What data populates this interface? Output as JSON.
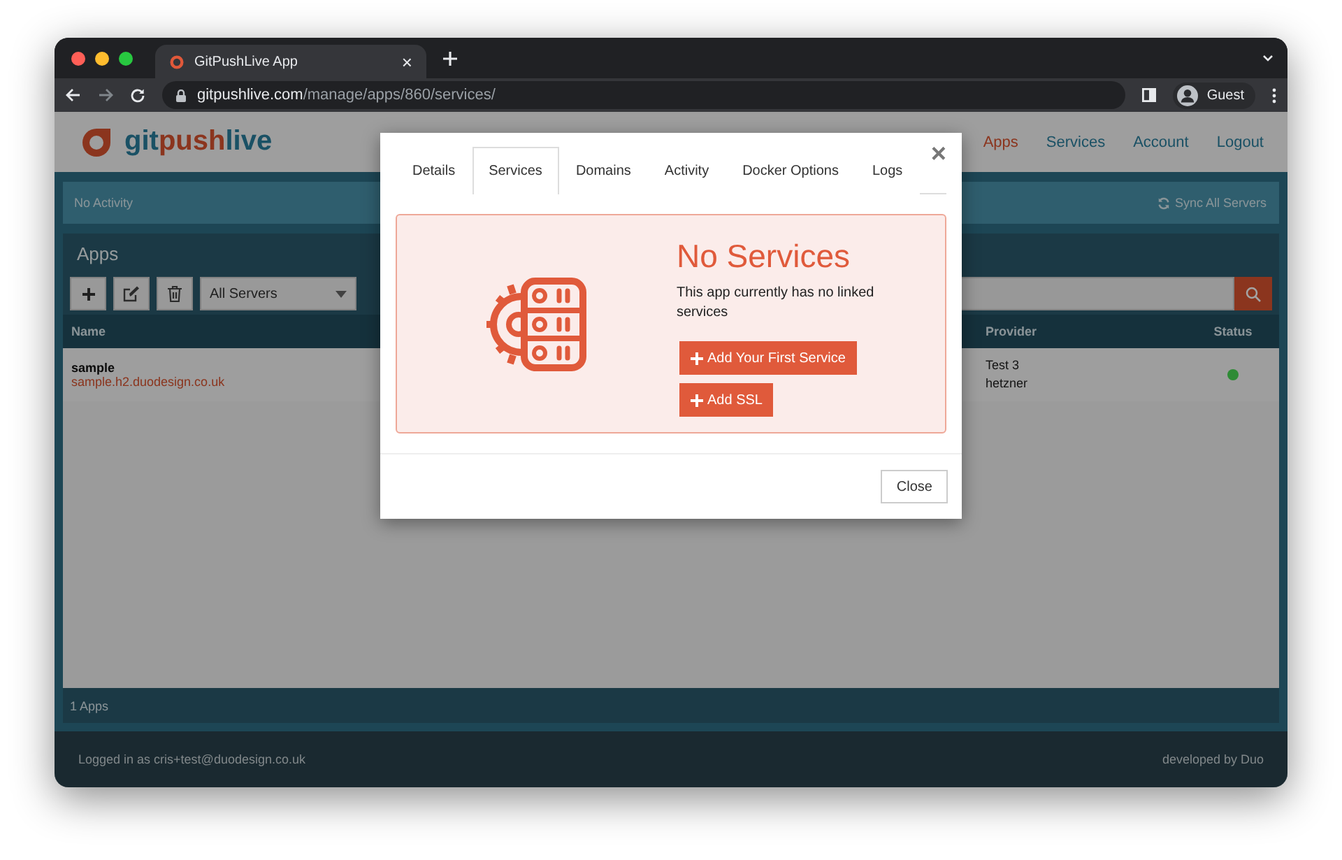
{
  "browser": {
    "tab_title": "GitPushLive App",
    "tab_close": "×",
    "url_host": "gitpushlive.com",
    "url_path": "/manage/apps/860/services/",
    "profile": "Guest"
  },
  "header": {
    "logo_parts": [
      "git",
      "push",
      "live"
    ],
    "nav": [
      {
        "label": "Apps",
        "selected": true
      },
      {
        "label": "Services",
        "selected": false
      },
      {
        "label": "Account",
        "selected": false
      },
      {
        "label": "Logout",
        "selected": false
      }
    ]
  },
  "activity": {
    "status": "No Activity",
    "sync": "Sync All Servers"
  },
  "apps_panel": {
    "title": "Apps",
    "filter": "All Servers",
    "columns": [
      "Name",
      "Provider",
      "Status"
    ],
    "rows": [
      {
        "name": "sample",
        "domain": "sample.h2.duodesign.co.uk",
        "provider": [
          "Test 3",
          "hetzner"
        ],
        "color": "#2e8b35"
      }
    ],
    "footer": "1 Apps"
  },
  "footer": {
    "login": "Logged in as cris+test@duodesign.co.uk",
    "credit": "developed by Duo"
  },
  "modal": {
    "close_icon": "×",
    "tabs": [
      {
        "label": "Details",
        "selected": false
      },
      {
        "label": "Services",
        "selected": true
      },
      {
        "label": "Domains",
        "selected": false
      },
      {
        "label": "Activity",
        "selected": false
      },
      {
        "label": "Docker Options",
        "selected": false
      },
      {
        "label": "Logs",
        "selected": false
      }
    ],
    "alert": {
      "title": "No Services",
      "message": "This app currently has no linked services",
      "buttons": [
        "Add Your First Service",
        "Add SSL"
      ]
    },
    "close_button": "Close"
  }
}
